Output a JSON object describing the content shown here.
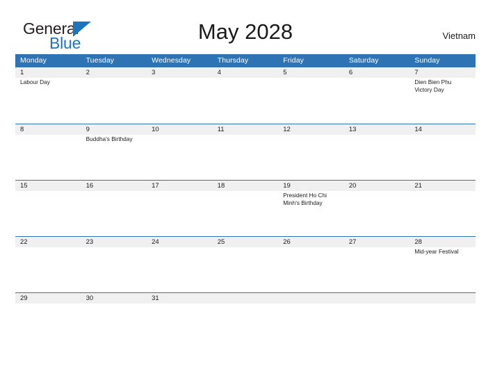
{
  "brand": {
    "name_part1": "General",
    "name_part2": "Blue",
    "flag_icon": "flag-icon",
    "color_dark": "#231f20",
    "color_blue": "#1c74bc"
  },
  "header": {
    "title": "May 2028",
    "country": "Vietnam"
  },
  "theme": {
    "header_blue": "#2e74b5",
    "row_band_gray": "#f0f0f0",
    "text": "#1a1a1a"
  },
  "calendar": {
    "month": "May",
    "year": "2028",
    "weekday_headers": [
      "Monday",
      "Tuesday",
      "Wednesday",
      "Thursday",
      "Friday",
      "Saturday",
      "Sunday"
    ],
    "weeks": [
      {
        "days": [
          {
            "number": "1",
            "events": [
              "Labour Day"
            ]
          },
          {
            "number": "2",
            "events": []
          },
          {
            "number": "3",
            "events": []
          },
          {
            "number": "4",
            "events": []
          },
          {
            "number": "5",
            "events": []
          },
          {
            "number": "6",
            "events": []
          },
          {
            "number": "7",
            "events": [
              "Dien Bien Phu",
              "Victory Day"
            ]
          }
        ]
      },
      {
        "days": [
          {
            "number": "8",
            "events": []
          },
          {
            "number": "9",
            "events": [
              "Buddha's Birthday"
            ]
          },
          {
            "number": "10",
            "events": []
          },
          {
            "number": "11",
            "events": []
          },
          {
            "number": "12",
            "events": []
          },
          {
            "number": "13",
            "events": []
          },
          {
            "number": "14",
            "events": []
          }
        ]
      },
      {
        "days": [
          {
            "number": "15",
            "events": []
          },
          {
            "number": "16",
            "events": []
          },
          {
            "number": "17",
            "events": []
          },
          {
            "number": "18",
            "events": []
          },
          {
            "number": "19",
            "events": [
              "President Ho Chi",
              "Minh's Birthday"
            ]
          },
          {
            "number": "20",
            "events": []
          },
          {
            "number": "21",
            "events": []
          }
        ]
      },
      {
        "days": [
          {
            "number": "22",
            "events": []
          },
          {
            "number": "23",
            "events": []
          },
          {
            "number": "24",
            "events": []
          },
          {
            "number": "25",
            "events": []
          },
          {
            "number": "26",
            "events": []
          },
          {
            "number": "27",
            "events": []
          },
          {
            "number": "28",
            "events": [
              "Mid-year Festival"
            ]
          }
        ]
      },
      {
        "days": [
          {
            "number": "29",
            "events": []
          },
          {
            "number": "30",
            "events": []
          },
          {
            "number": "31",
            "events": []
          },
          {
            "number": "",
            "events": []
          },
          {
            "number": "",
            "events": []
          },
          {
            "number": "",
            "events": []
          },
          {
            "number": "",
            "events": []
          }
        ]
      }
    ]
  }
}
